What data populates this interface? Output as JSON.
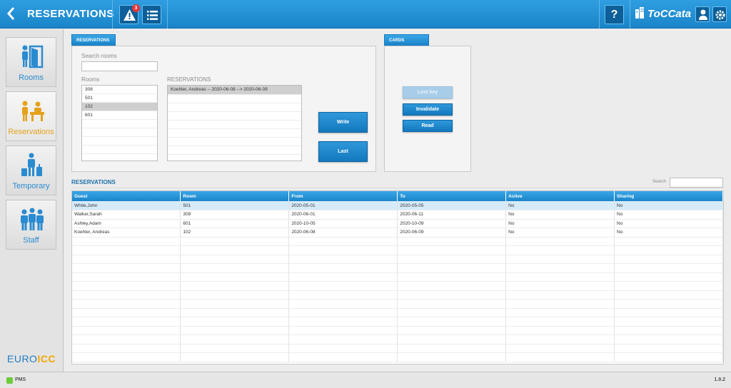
{
  "header": {
    "title": "RESERVATIONS",
    "alert_count": "3",
    "brand": "ToCCata",
    "back_icon": "chevron-left-icon",
    "alert_icon": "warning-triangle-icon",
    "list_icon": "list-icon",
    "help_label": "?",
    "user_icon": "user-icon",
    "settings_icon": "gear-icon"
  },
  "sidebar": {
    "items": [
      {
        "label": "Rooms",
        "icon": "room-door-icon"
      },
      {
        "label": "Reservations",
        "icon": "reception-desk-icon"
      },
      {
        "label": "Temporary",
        "icon": "traveler-luggage-icon"
      },
      {
        "label": "Staff",
        "icon": "staff-group-icon"
      }
    ],
    "logo_a": "EURO",
    "logo_b": "ICC"
  },
  "reservations_panel": {
    "tab": "RESERVATIONS",
    "search_label": "Search rooms",
    "search_value": "",
    "rooms_label": "Rooms",
    "rooms": [
      "308",
      "501",
      "102",
      "601"
    ],
    "selected_room": "102",
    "res_label": "RESERVATIONS",
    "reservations": [
      "Koehler, Andreas -- 2020-06-08 --> 2020-06-09"
    ],
    "write_button": "Write",
    "last_button": "Last"
  },
  "cards_panel": {
    "tab": "CARDS",
    "lost_key": "Lost key",
    "invalidate": "Invalidate",
    "read": "Read"
  },
  "list_section": {
    "title": "RESERVATIONS",
    "search_label": "Search",
    "search_value": "",
    "columns": [
      "Guest",
      "Room",
      "From",
      "To",
      "Active",
      "Sharing"
    ],
    "rows": [
      [
        "White,John",
        "501",
        "2020-05-01",
        "2020-05-05",
        "No",
        "No"
      ],
      [
        "Walker,Sarah",
        "308",
        "2020-06-01",
        "2020-06-11",
        "No",
        "No"
      ],
      [
        "Ashley,Adam",
        "601",
        "2020-10-05",
        "2020-10-09",
        "No",
        "No"
      ],
      [
        "Koehler, Andreas",
        "102",
        "2020-06-08",
        "2020-06-09",
        "No",
        "No"
      ]
    ],
    "selected_row": 0,
    "empty_rows": 14
  },
  "status": {
    "text": "PMS",
    "version": "1.9.2",
    "ok_color": "#6ccb3b"
  },
  "colors": {
    "accent": "#1a84c9",
    "active_nav": "#e4a21a"
  }
}
